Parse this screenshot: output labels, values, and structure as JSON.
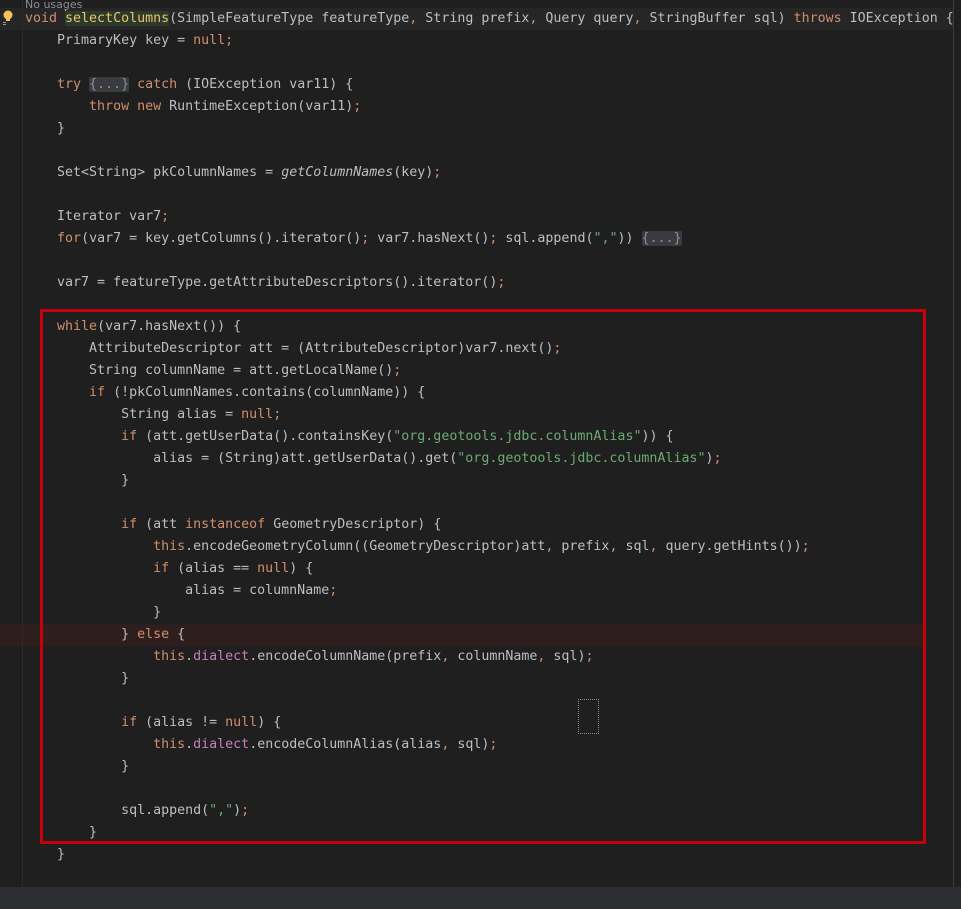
{
  "editor": {
    "inlay_hint": "No usages",
    "colors": {
      "keyword": "#cf8e6d",
      "string": "#6aab73",
      "field": "#c77dbb",
      "text": "#bcbec4",
      "highlight_box": "#c8000a"
    },
    "lines": [
      [
        [
          "k",
          "void "
        ],
        [
          "cursor",
          ""
        ],
        [
          "m",
          "selectColumns"
        ],
        [
          "p",
          "(SimpleFeatureType featureType"
        ],
        [
          "c",
          ","
        ],
        [
          "p",
          " String prefix"
        ],
        [
          "c",
          ","
        ],
        [
          "p",
          " Query query"
        ],
        [
          "c",
          ","
        ],
        [
          "p",
          " StringBuffer sql) "
        ],
        [
          "k",
          "throws"
        ],
        [
          "p",
          " IOException {"
        ]
      ],
      [
        [
          "p",
          "    PrimaryKey key = "
        ],
        [
          "k",
          "null"
        ],
        [
          "c",
          ";"
        ]
      ],
      [],
      [
        [
          "p",
          "    "
        ],
        [
          "k",
          "try"
        ],
        [
          "p",
          " "
        ],
        [
          "fold",
          "{...}"
        ],
        [
          "p",
          " "
        ],
        [
          "k",
          "catch"
        ],
        [
          "p",
          " (IOException var11) {"
        ]
      ],
      [
        [
          "p",
          "        "
        ],
        [
          "k",
          "throw"
        ],
        [
          "p",
          " "
        ],
        [
          "k",
          "new"
        ],
        [
          "p",
          " RuntimeException(var11)"
        ],
        [
          "c",
          ";"
        ]
      ],
      [
        [
          "p",
          "    }"
        ]
      ],
      [],
      [
        [
          "p",
          "    Set<String> pkColumnNames = "
        ],
        [
          "i",
          "getColumnNames"
        ],
        [
          "p",
          "(key)"
        ],
        [
          "c",
          ";"
        ]
      ],
      [],
      [
        [
          "p",
          "    Iterator var7"
        ],
        [
          "c",
          ";"
        ]
      ],
      [
        [
          "p",
          "    "
        ],
        [
          "k",
          "for"
        ],
        [
          "p",
          "(var7 = key.getColumns().iterator()"
        ],
        [
          "c",
          ";"
        ],
        [
          "p",
          " var7.hasNext()"
        ],
        [
          "c",
          ";"
        ],
        [
          "p",
          " sql.append("
        ],
        [
          "s",
          "\",\""
        ],
        [
          "p",
          "))"
        ],
        [
          "p",
          " "
        ],
        [
          "fold",
          "{...}"
        ]
      ],
      [],
      [
        [
          "p",
          "    var7 = featureType.getAttributeDescriptors().iterator()"
        ],
        [
          "c",
          ";"
        ]
      ],
      [],
      [
        [
          "p",
          "    "
        ],
        [
          "k",
          "while"
        ],
        [
          "p",
          "(var7.hasNext()) {"
        ]
      ],
      [
        [
          "p",
          "        AttributeDescriptor att = (AttributeDescriptor)var7.next()"
        ],
        [
          "c",
          ";"
        ]
      ],
      [
        [
          "p",
          "        String columnName = att.getLocalName()"
        ],
        [
          "c",
          ";"
        ]
      ],
      [
        [
          "p",
          "        "
        ],
        [
          "k",
          "if"
        ],
        [
          "p",
          " (!pkColumnNames.contains(columnName)) {"
        ]
      ],
      [
        [
          "p",
          "            String alias = "
        ],
        [
          "k",
          "null"
        ],
        [
          "c",
          ";"
        ]
      ],
      [
        [
          "p",
          "            "
        ],
        [
          "k",
          "if"
        ],
        [
          "p",
          " (att.getUserData().containsKey("
        ],
        [
          "s",
          "\"org.geotools.jdbc.columnAlias\""
        ],
        [
          "p",
          ")) {"
        ]
      ],
      [
        [
          "p",
          "                alias = (String)att.getUserData().get("
        ],
        [
          "s",
          "\"org.geotools.jdbc.columnAlias\""
        ],
        [
          "p",
          ")"
        ],
        [
          "c",
          ";"
        ]
      ],
      [
        [
          "p",
          "            }"
        ]
      ],
      [],
      [
        [
          "p",
          "            "
        ],
        [
          "k",
          "if"
        ],
        [
          "p",
          " (att "
        ],
        [
          "k",
          "instanceof"
        ],
        [
          "p",
          " GeometryDescriptor) {"
        ]
      ],
      [
        [
          "p",
          "                "
        ],
        [
          "k",
          "this"
        ],
        [
          "p",
          ".encodeGeometryColumn((GeometryDescriptor)att"
        ],
        [
          "c",
          ","
        ],
        [
          "p",
          " prefix"
        ],
        [
          "c",
          ","
        ],
        [
          "p",
          " sql"
        ],
        [
          "c",
          ","
        ],
        [
          "p",
          " query.getHints())"
        ],
        [
          "c",
          ";"
        ]
      ],
      [
        [
          "p",
          "                "
        ],
        [
          "k",
          "if"
        ],
        [
          "p",
          " (alias == "
        ],
        [
          "k",
          "null"
        ],
        [
          "p",
          ") {"
        ]
      ],
      [
        [
          "p",
          "                    alias = columnName"
        ],
        [
          "c",
          ";"
        ]
      ],
      [
        [
          "p",
          "                }"
        ]
      ],
      [
        [
          "p",
          "            } "
        ],
        [
          "k",
          "else"
        ],
        [
          "p",
          " {"
        ]
      ],
      [
        [
          "p",
          "                "
        ],
        [
          "k",
          "this"
        ],
        [
          "p",
          "."
        ],
        [
          "f",
          "dialect"
        ],
        [
          "p",
          ".encodeColumnName(prefix"
        ],
        [
          "c",
          ","
        ],
        [
          "p",
          " columnName"
        ],
        [
          "c",
          ","
        ],
        [
          "p",
          " sql)"
        ],
        [
          "c",
          ";"
        ]
      ],
      [
        [
          "p",
          "            }"
        ]
      ],
      [],
      [
        [
          "p",
          "            "
        ],
        [
          "k",
          "if"
        ],
        [
          "p",
          " (alias != "
        ],
        [
          "k",
          "null"
        ],
        [
          "p",
          ") {"
        ]
      ],
      [
        [
          "p",
          "                "
        ],
        [
          "k",
          "this"
        ],
        [
          "p",
          "."
        ],
        [
          "f",
          "dialect"
        ],
        [
          "p",
          ".encodeColumnAlias(alias"
        ],
        [
          "c",
          ","
        ],
        [
          "p",
          " sql)"
        ],
        [
          "c",
          ";"
        ]
      ],
      [
        [
          "p",
          "            }"
        ]
      ],
      [],
      [
        [
          "p",
          "            sql.append("
        ],
        [
          "s",
          "\",\""
        ],
        [
          "p",
          ")"
        ],
        [
          "c",
          ";"
        ]
      ],
      [
        [
          "p",
          "        }"
        ]
      ],
      [
        [
          "p",
          "    }"
        ]
      ]
    ]
  }
}
